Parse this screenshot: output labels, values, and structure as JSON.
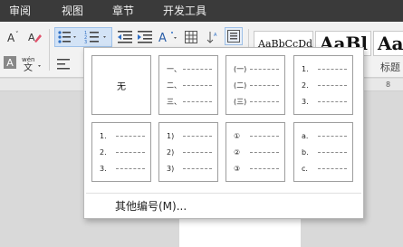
{
  "menu": [
    "审阅",
    "视图",
    "章节",
    "开发工具"
  ],
  "toolbar": {
    "style_samples": [
      "AaBbCcDd",
      "AaBl",
      "Aal"
    ],
    "style_caption": "标题"
  },
  "ruler": {
    "mark": "8"
  },
  "numbering_menu": {
    "none_label": "无",
    "styles": [
      {
        "markers": [
          "一、",
          "二、",
          "三、"
        ]
      },
      {
        "markers": [
          "(一)",
          "(二)",
          "(三)"
        ]
      },
      {
        "markers": [
          "1.",
          "2.",
          "3."
        ]
      },
      {
        "markers": [
          "1.",
          "2.",
          "3."
        ]
      },
      {
        "markers": [
          "1)",
          "2)",
          "3)"
        ]
      },
      {
        "markers": [
          "①",
          "②",
          "③"
        ]
      },
      {
        "markers": [
          "a.",
          "b.",
          "c."
        ]
      }
    ],
    "more_label": "其他编号(M)..."
  }
}
